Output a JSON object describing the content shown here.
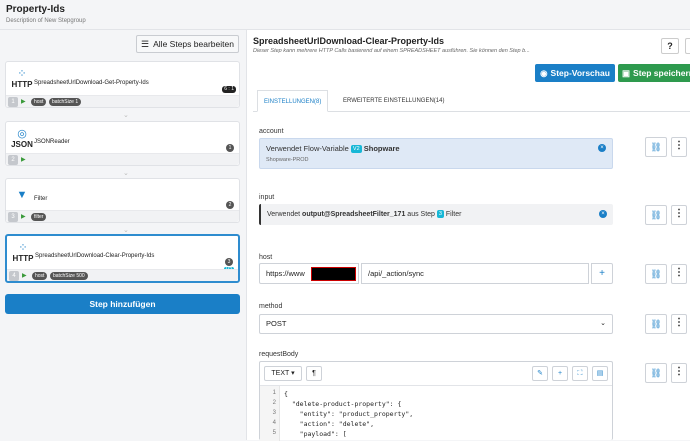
{
  "header": {
    "title": "Property-Ids",
    "description": "Description of New Stepgroup"
  },
  "left": {
    "edit_all_label": "Alle Steps bearbeiten",
    "add_step_label": "Step hinzufügen",
    "steps": [
      {
        "type": "HTTP",
        "name": "SpreadsheetUrlDownload-Get-Property-Ids",
        "number": "1",
        "tags": [
          "host",
          "batchSize 1"
        ],
        "badge": "6 : 1",
        "version": "V2"
      },
      {
        "type": "JSON",
        "name": "JSONReader",
        "number": "2",
        "tags": [],
        "count": "1"
      },
      {
        "type": "Filter",
        "name": "Filter",
        "number": "3",
        "tags": [
          "filter"
        ],
        "count": "2"
      },
      {
        "type": "HTTP",
        "name": "SpreadsheetUrlDownload-Clear-Property-Ids",
        "number": "4",
        "tags": [
          "host",
          "batchSize 500"
        ],
        "count": "3",
        "version": "V2"
      }
    ]
  },
  "right": {
    "title": "SpreadsheetUrlDownload-Clear-Property-Ids",
    "description": "Dieser Step kann mehrere HTTP Calls basierend auf einem SPREADSHEET ausführen. Sie können den Step b...",
    "help_label": "?",
    "preview_label": "Step-Vorschau",
    "save_label": "Step speichern",
    "tabs": [
      "EINSTELLUNGEN(8)",
      "ERWEITERTE EINSTELLUNGEN(14)"
    ],
    "account": {
      "label": "account",
      "prefix": "Verwendet Flow-Variable",
      "badge": "V2",
      "value": "Shopware",
      "sub": "Shopware-PROD"
    },
    "input": {
      "label": "input",
      "prefix": "Verwendet",
      "ref": "output@SpreadsheetFilter_171",
      "mid": "aus Step",
      "step_no": "3",
      "step_name": "Filter"
    },
    "host": {
      "label": "host",
      "part1": "https://www",
      "part2": "/api/_action/sync"
    },
    "method": {
      "label": "method",
      "value": "POST"
    },
    "requestBody": {
      "label": "requestBody",
      "mode": "TEXT",
      "lines": [
        "{",
        "  \"delete-product-property\": {",
        "    \"entity\": \"product_property\",",
        "    \"action\": \"delete\",",
        "    \"payload\": ["
      ],
      "line_numbers": [
        "1",
        "2",
        "3",
        "4",
        "5"
      ]
    }
  }
}
